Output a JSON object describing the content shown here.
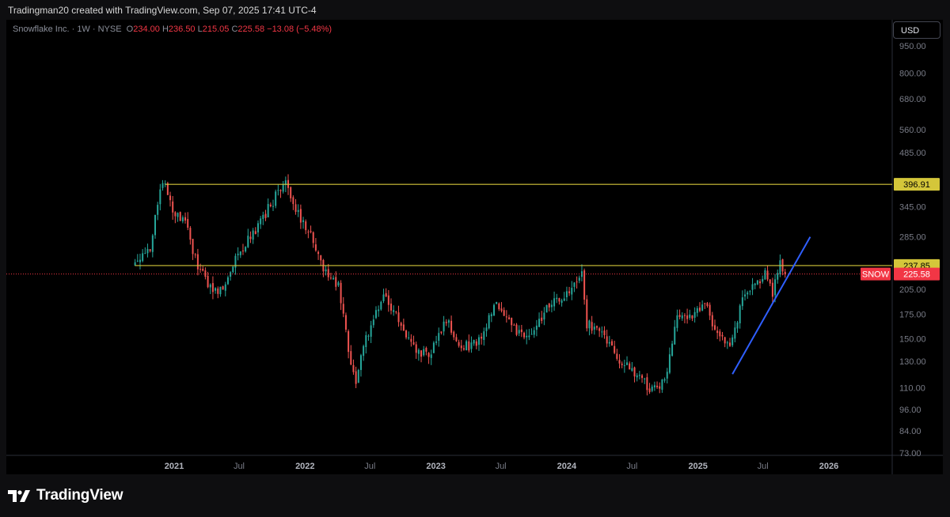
{
  "header": {
    "credit": "Tradingman20 created with TradingView.com, Sep 07, 2025 17:41 UTC-4"
  },
  "legend": {
    "symbol_desc": "Snowflake Inc. · 1W · NYSE",
    "o_label": "O",
    "o_value": "234.00",
    "h_label": "H",
    "h_value": "236.50",
    "l_label": "L",
    "l_value": "215.05",
    "c_label": "C",
    "c_value": "225.58",
    "change": "−13.08 (−5.48%)"
  },
  "currency_button": "USD",
  "footer": {
    "brand": "TradingView"
  },
  "colors": {
    "up": "#26a69a",
    "down": "#ef5350",
    "hline": "#d4c63a",
    "trend": "#2f5fff",
    "current": "#f23645",
    "background": "#000000"
  },
  "chart_data": {
    "type": "candlestick",
    "timeframe": "1W",
    "scale": "log",
    "ylim": [
      73,
      1000
    ],
    "y_ticks": [
      "950.00",
      "800.00",
      "680.00",
      "560.00",
      "485.00",
      "345.00",
      "285.00",
      "205.00",
      "175.00",
      "150.00",
      "130.00",
      "110.00",
      "96.00",
      "84.00",
      "73.00"
    ],
    "x_ticks": [
      "2021",
      "Jul",
      "2022",
      "Jul",
      "2023",
      "Jul",
      "2024",
      "Jul",
      "2025",
      "Jul",
      "2026"
    ],
    "horizontal_lines": [
      {
        "label": "396.91",
        "value": 396.91,
        "color": "#d4c63a"
      },
      {
        "label": "237.85",
        "value": 237.85,
        "color": "#d4c63a"
      }
    ],
    "current_price": {
      "symbol": "SNOW",
      "label": "225.58",
      "value": 225.58
    },
    "trend_line": {
      "from": [
        "2025-04-07",
        120
      ],
      "to": [
        "2025-11-10",
        285
      ]
    },
    "anchors": [
      [
        "2020-09-14",
        240
      ],
      [
        "2020-11-02",
        270
      ],
      [
        "2020-12-07",
        410
      ],
      [
        "2021-01-04",
        330
      ],
      [
        "2021-02-08",
        310
      ],
      [
        "2021-03-15",
        235
      ],
      [
        "2021-05-10",
        195
      ],
      [
        "2021-06-21",
        245
      ],
      [
        "2021-08-23",
        300
      ],
      [
        "2021-10-04",
        350
      ],
      [
        "2021-11-15",
        405
      ],
      [
        "2021-12-13",
        335
      ],
      [
        "2022-01-17",
        300
      ],
      [
        "2022-02-28",
        235
      ],
      [
        "2022-03-14",
        225
      ],
      [
        "2022-04-11",
        210
      ],
      [
        "2022-05-09",
        140
      ],
      [
        "2022-05-30",
        115
      ],
      [
        "2022-06-27",
        150
      ],
      [
        "2022-08-15",
        195
      ],
      [
        "2022-09-26",
        170
      ],
      [
        "2022-11-07",
        140
      ],
      [
        "2022-12-19",
        135
      ],
      [
        "2023-02-06",
        170
      ],
      [
        "2023-03-20",
        140
      ],
      [
        "2023-05-08",
        150
      ],
      [
        "2023-06-26",
        185
      ],
      [
        "2023-08-14",
        160
      ],
      [
        "2023-10-02",
        150
      ],
      [
        "2023-11-13",
        185
      ],
      [
        "2024-01-15",
        200
      ],
      [
        "2024-02-19",
        230
      ],
      [
        "2024-03-04",
        165
      ],
      [
        "2024-04-22",
        155
      ],
      [
        "2024-06-03",
        130
      ],
      [
        "2024-07-22",
        120
      ],
      [
        "2024-08-26",
        110
      ],
      [
        "2024-10-07",
        115
      ],
      [
        "2024-11-11",
        180
      ],
      [
        "2024-12-16",
        170
      ],
      [
        "2025-01-27",
        190
      ],
      [
        "2025-02-24",
        155
      ],
      [
        "2025-04-07",
        140
      ],
      [
        "2025-05-12",
        195
      ],
      [
        "2025-06-16",
        215
      ],
      [
        "2025-07-14",
        225
      ],
      [
        "2025-08-04",
        200
      ],
      [
        "2025-08-25",
        238
      ],
      [
        "2025-09-02",
        225.58
      ]
    ]
  }
}
